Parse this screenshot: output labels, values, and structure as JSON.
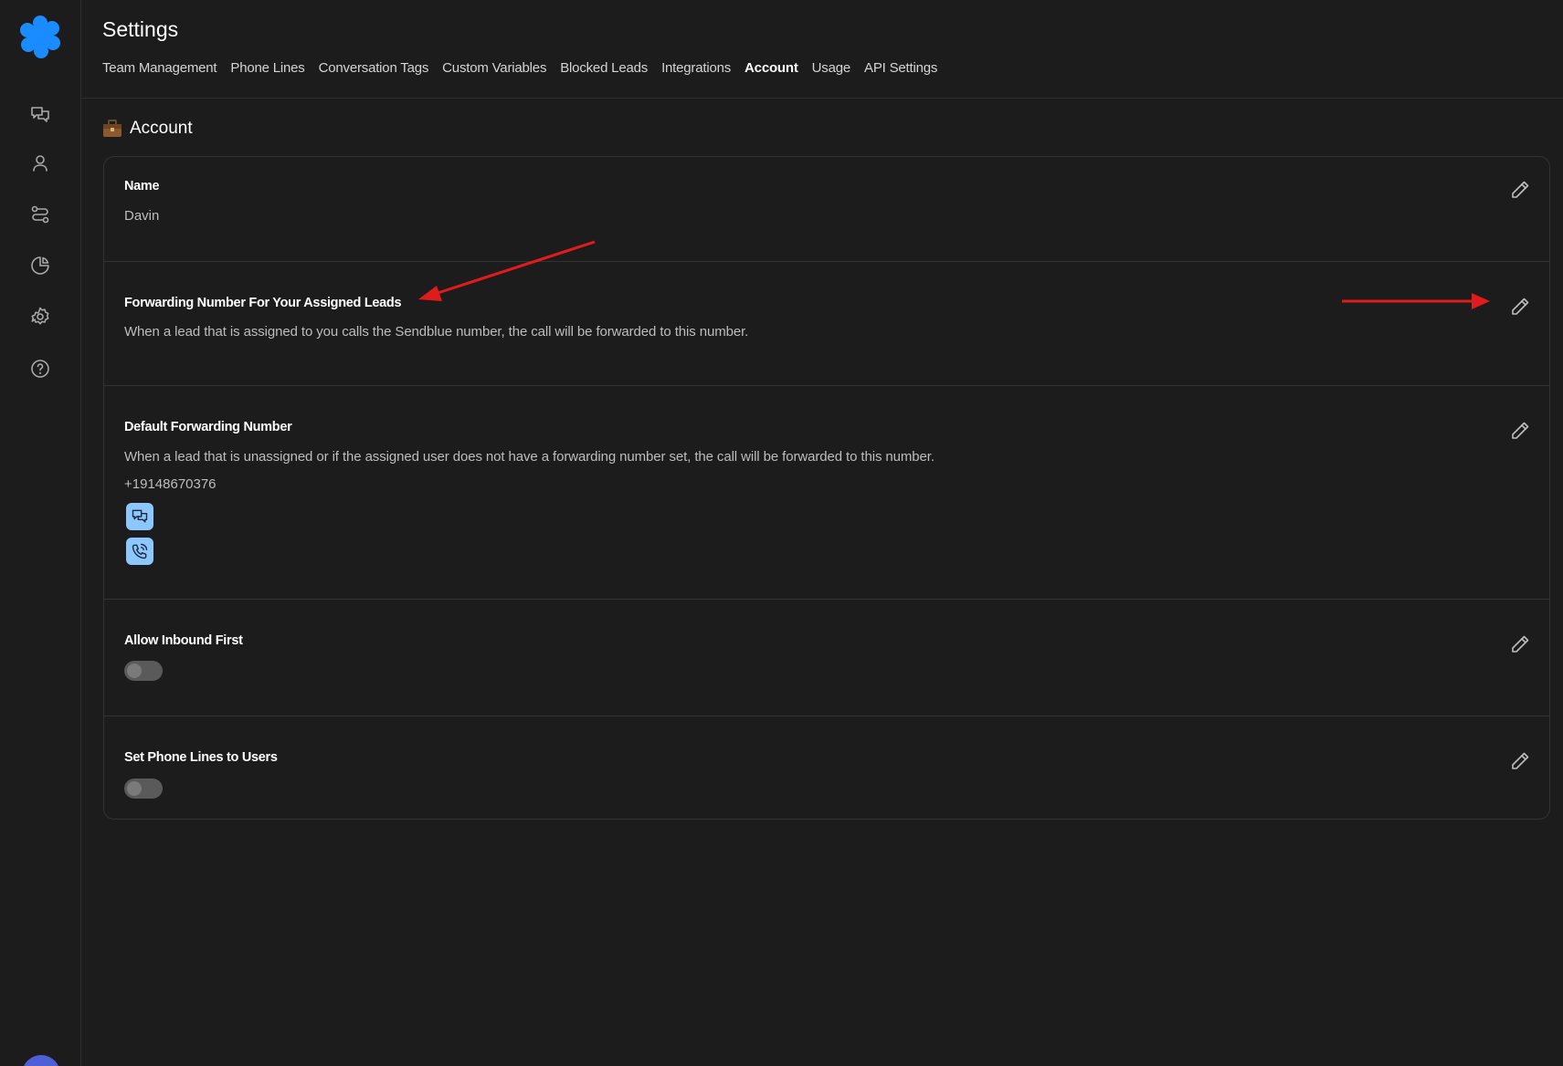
{
  "sidebar": {
    "logo": "sendblue-logo",
    "items": [
      {
        "icon": "chat-icon"
      },
      {
        "icon": "user-icon"
      },
      {
        "icon": "workflow-icon"
      },
      {
        "icon": "pie-chart-icon"
      },
      {
        "icon": "gear-icon"
      },
      {
        "icon": "help-icon"
      }
    ]
  },
  "header": {
    "title": "Settings",
    "tabs": [
      {
        "label": "Team Management"
      },
      {
        "label": "Phone Lines"
      },
      {
        "label": "Conversation Tags"
      },
      {
        "label": "Custom Variables"
      },
      {
        "label": "Blocked Leads"
      },
      {
        "label": "Integrations"
      },
      {
        "label": "Account",
        "active": true
      },
      {
        "label": "Usage"
      },
      {
        "label": "API Settings"
      }
    ]
  },
  "section": {
    "icon": "briefcase-icon",
    "title": "Account"
  },
  "rows": {
    "name": {
      "title": "Name",
      "value": "Davin"
    },
    "assigned_forwarding": {
      "title": "Forwarding Number For Your Assigned Leads",
      "description": "When a lead that is assigned to you calls the Sendblue number, the call will be forwarded to this number."
    },
    "default_forwarding": {
      "title": "Default Forwarding Number",
      "description": "When a lead that is unassigned or if the assigned user does not have a forwarding number set, the call will be forwarded to this number.",
      "value": "+19148670376"
    },
    "allow_inbound": {
      "title": "Allow Inbound First",
      "enabled": false
    },
    "phone_lines_to_users": {
      "title": "Set Phone Lines to Users",
      "enabled": false
    }
  },
  "colors": {
    "background": "#1c1c1c",
    "accent": "#1a8cff",
    "chip": "#8cc7ff",
    "annotation": "#e01b1b"
  }
}
